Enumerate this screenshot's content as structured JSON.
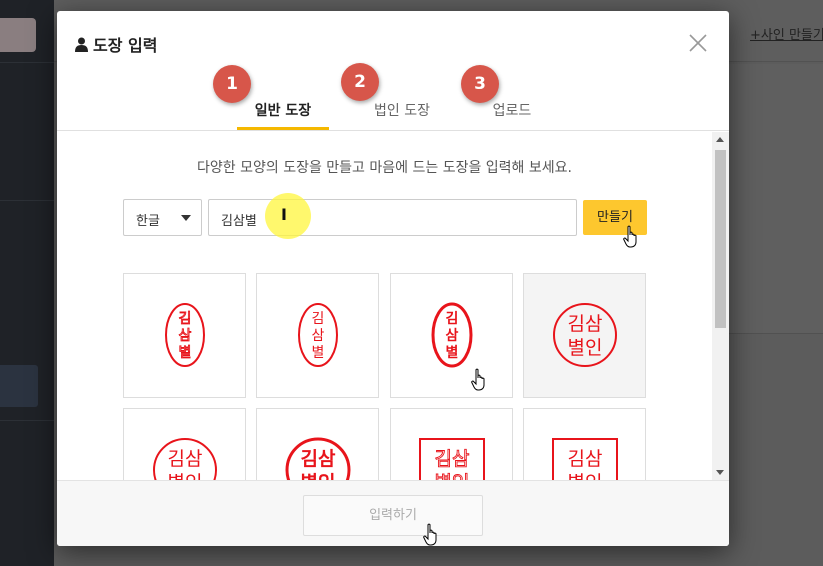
{
  "background": {
    "sign_link": "+사인 만들기"
  },
  "modal": {
    "title": "도장 입력",
    "tabs": [
      {
        "label": "일반 도장",
        "badge": "1"
      },
      {
        "label": "법인 도장",
        "badge": "2"
      },
      {
        "label": "업로드",
        "badge": "3"
      }
    ],
    "description": "다양한 모양의 도장을 만들고 마음에 드는 도장을 입력해 보세요.",
    "language_select": "한글",
    "name_input": "김삼별",
    "make_button": "만들기",
    "submit_button": "입력하기"
  },
  "stamps": [
    {
      "style": "oval-thin",
      "lines": [
        "김",
        "삼",
        "별"
      ]
    },
    {
      "style": "oval-regular",
      "lines": [
        "김",
        "삼",
        "별"
      ]
    },
    {
      "style": "oval-bold",
      "lines": [
        "김",
        "삼",
        "별"
      ]
    },
    {
      "style": "circle-square",
      "lines": [
        "김삼",
        "별인"
      ]
    },
    {
      "style": "circle-regular",
      "lines": [
        "김삼",
        "별인"
      ]
    },
    {
      "style": "circle-bold",
      "lines": [
        "김삼",
        "별인"
      ]
    },
    {
      "style": "square-thin",
      "lines": [
        "김삼",
        "별인"
      ]
    },
    {
      "style": "square-regular",
      "lines": [
        "김삼",
        "별인"
      ]
    }
  ],
  "colors": {
    "stamp_red": "#e8141b",
    "accent_yellow": "#fdc72e",
    "badge_red": "#d7564a"
  }
}
